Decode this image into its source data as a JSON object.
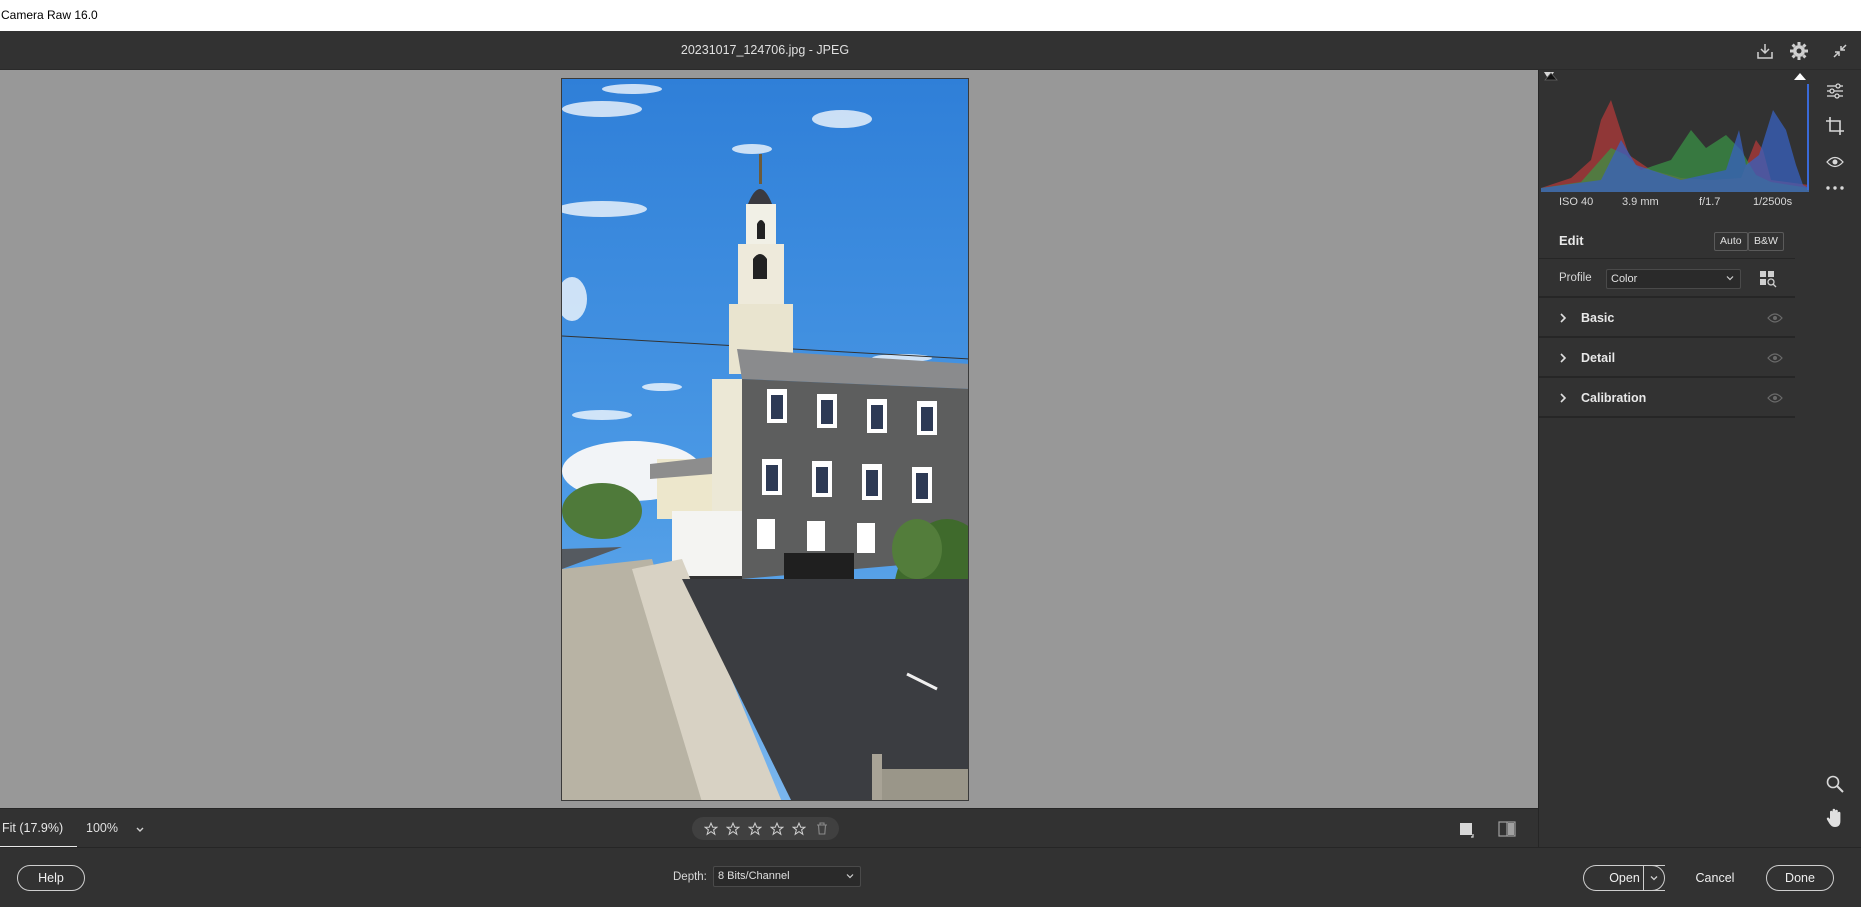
{
  "os_window": {
    "title": "Camera Raw 16.0"
  },
  "header": {
    "file_title": "20231017_124706.jpg  -  JPEG",
    "icons": [
      "save-icon",
      "gear-icon",
      "fullscreen-toggle-icon"
    ]
  },
  "histogram": {
    "exif": {
      "iso": "ISO 40",
      "focal": "3.9 mm",
      "aperture": "f/1.7",
      "shutter": "1/2500s"
    }
  },
  "edit_panel": {
    "title": "Edit",
    "auto_label": "Auto",
    "bw_label": "B&W",
    "profile_label": "Profile",
    "profile_value": "Color",
    "sections": [
      {
        "label": "Basic"
      },
      {
        "label": "Detail"
      },
      {
        "label": "Calibration"
      }
    ]
  },
  "canvas_toolbar": {
    "zoom_fit": "Fit (17.9%)",
    "zoom_100": "100%",
    "rating": 0
  },
  "tool_strip": [
    "edit-sliders-icon",
    "crop-icon",
    "redeye-icon",
    "more-icon",
    "zoom-icon",
    "hand-icon"
  ],
  "footer": {
    "help_label": "Help",
    "depth_label": "Depth:",
    "depth_value": "8 Bits/Channel",
    "open_label": "Open",
    "cancel_label": "Cancel",
    "done_label": "Done"
  },
  "colors": {
    "panel": "#323232",
    "canvas": "#989898",
    "sky": "#3f8fe0"
  }
}
